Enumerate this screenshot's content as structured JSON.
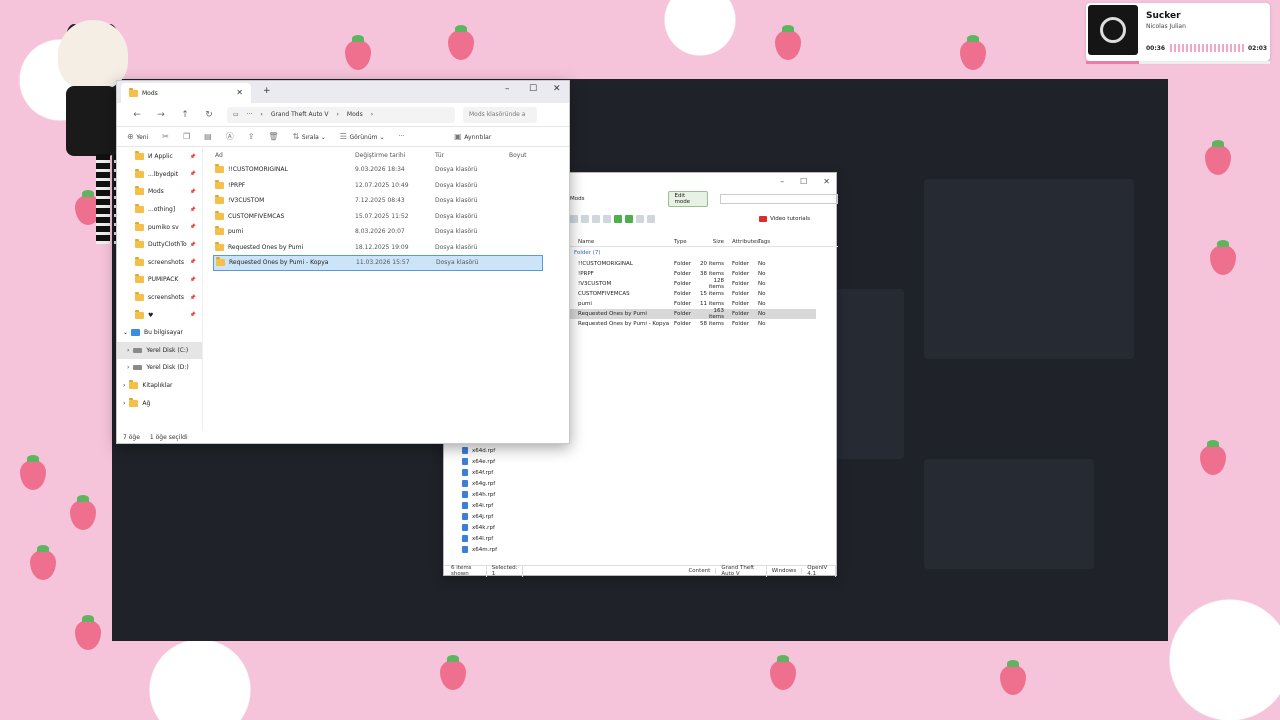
{
  "now_playing": {
    "title": "Sucker",
    "artist": "Nicolas Julian",
    "current_time": "00:36",
    "total_time": "02:03",
    "progress": 0.29
  },
  "explorer": {
    "tab_title": "Mods",
    "breadcrumb": [
      "Grand Theft Auto V",
      "Mods"
    ],
    "search_placeholder": "Mods klasöründe a",
    "toolbar": {
      "new": "Yeni",
      "sort": "Sırala",
      "view": "Görünüm",
      "more": "···",
      "details": "Ayrıntılar"
    },
    "nav_items": [
      {
        "label": "И Applic",
        "pinned": true
      },
      {
        "label": "...lbyedpit",
        "pinned": true
      },
      {
        "label": "Mods",
        "pinned": true
      },
      {
        "label": "...othing]",
        "pinned": true
      },
      {
        "label": "pumiko sv",
        "pinned": true
      },
      {
        "label": "DuttyClothTo",
        "pinned": true
      },
      {
        "label": "screenshots",
        "pinned": true
      },
      {
        "label": "PUMIPACK",
        "pinned": true
      },
      {
        "label": "screenshots",
        "pinned": true
      },
      {
        "label": "♥",
        "pinned": true
      }
    ],
    "this_pc": "Bu bilgisayar",
    "drives": [
      "Yerel Disk (C:)",
      "Yerel Disk (D:)"
    ],
    "libraries": "Kitaplıklar",
    "network": "Ağ",
    "columns": [
      "Ad",
      "Değiştirme tarihi",
      "Tür",
      "Boyut"
    ],
    "rows": [
      {
        "name": "!!CUSTOMORIGINAL",
        "date": "9.03.2026 18:34",
        "type": "Dosya klasörü"
      },
      {
        "name": "!PRPF",
        "date": "12.07.2025 10:49",
        "type": "Dosya klasörü"
      },
      {
        "name": "!V3CUSTOM",
        "date": "7.12.2025 08:43",
        "type": "Dosya klasörü"
      },
      {
        "name": "CUSTOMFIVEMCAS",
        "date": "15.07.2025 11:52",
        "type": "Dosya klasörü"
      },
      {
        "name": "pumi",
        "date": "8.03.2026 20:07",
        "type": "Dosya klasörü"
      },
      {
        "name": "Requested Ones by Pumi",
        "date": "18.12.2025 19:09",
        "type": "Dosya klasörü"
      },
      {
        "name": "Requested Ones by Pumi - Kopya",
        "date": "11.03.2026 15:57",
        "type": "Dosya klasörü",
        "selected": true
      }
    ],
    "status_count": "7 öğe",
    "status_selected": "1 öğe seçildi"
  },
  "openiv": {
    "path": "Mods",
    "edit_mode": "Edit mode",
    "video_tutorials": "Video tutorials",
    "columns": [
      "Name",
      "Type",
      "Size",
      "Attributes",
      "Tags"
    ],
    "group": "Folder (7)",
    "rows": [
      {
        "name": "!!CUSTOMORIGINAL",
        "type": "Folder",
        "size": "20 items",
        "attr": "Folder",
        "tags": "No"
      },
      {
        "name": "!PRPF",
        "type": "Folder",
        "size": "38 items",
        "attr": "Folder",
        "tags": "No"
      },
      {
        "name": "!V3CUSTOM",
        "type": "Folder",
        "size": "128 items",
        "attr": "Folder",
        "tags": "No"
      },
      {
        "name": "CUSTOMFIVEMCAS",
        "type": "Folder",
        "size": "15 items",
        "attr": "Folder",
        "tags": "No"
      },
      {
        "name": "pumi",
        "type": "Folder",
        "size": "11 items",
        "attr": "Folder",
        "tags": "No"
      },
      {
        "name": "Requested Ones by Pumi",
        "type": "Folder",
        "size": "163 items",
        "attr": "Folder",
        "tags": "No",
        "selected": true
      },
      {
        "name": "Requested Ones by Pumi - Kopya",
        "type": "Folder",
        "size": "58 items",
        "attr": "Folder",
        "tags": "No"
      }
    ],
    "tree_files": [
      "x64d.rpf",
      "x64e.rpf",
      "x64f.rpf",
      "x64g.rpf",
      "x64h.rpf",
      "x64i.rpf",
      "x64j.rpf",
      "x64k.rpf",
      "x64l.rpf",
      "x64m.rpf"
    ],
    "status": {
      "items_shown": "6 items shown",
      "selected": "Selected: 1",
      "content": "Content",
      "game": "Grand Theft Auto V",
      "platform": "Windows",
      "version": "OpenIV 4.1"
    }
  },
  "colors": {
    "overlay_pink": "#f6c4da",
    "strawberry": "#ef6f8e",
    "selection": "#cce4f7",
    "desktop": "#1f2329"
  }
}
